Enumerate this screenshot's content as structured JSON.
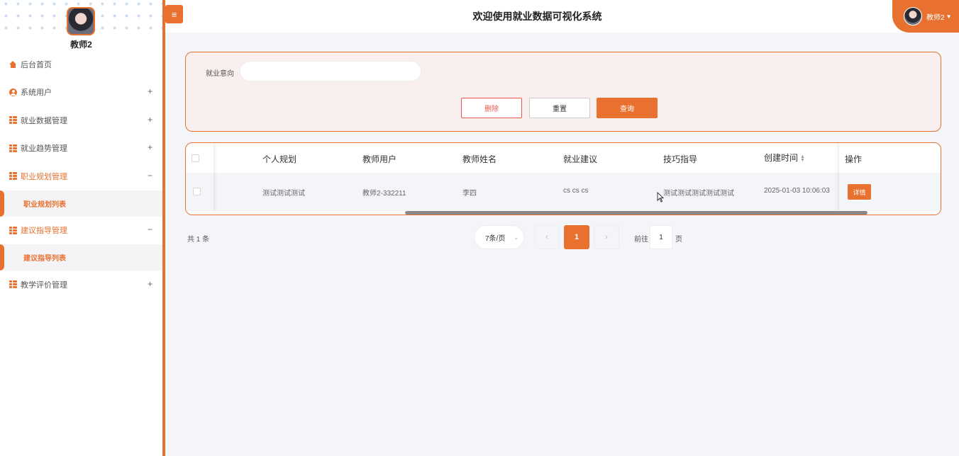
{
  "sidebar": {
    "user_name": "教师2",
    "items": [
      {
        "label": "后台首页",
        "icon": "home-icon",
        "toggle": ""
      },
      {
        "label": "系统用户",
        "icon": "user-icon",
        "toggle": "+"
      },
      {
        "label": "就业数据管理",
        "icon": "grid-icon",
        "toggle": "+"
      },
      {
        "label": "就业趋势管理",
        "icon": "grid-icon",
        "toggle": "+"
      },
      {
        "label": "职业规划管理",
        "icon": "grid-icon",
        "toggle": "−",
        "sub": "职业规划列表"
      },
      {
        "label": "建议指导管理",
        "icon": "grid-icon",
        "toggle": "−",
        "sub": "建议指导列表"
      },
      {
        "label": "教学评价管理",
        "icon": "grid-icon",
        "toggle": "+"
      }
    ]
  },
  "header": {
    "title": "欢迎使用就业数据可视化系统",
    "user": "教师2",
    "menu_icon": "≡"
  },
  "search": {
    "label": "就业意向",
    "value": "",
    "buttons": {
      "delete": "删除",
      "reset": "重置",
      "query": "查询"
    }
  },
  "table": {
    "columns": [
      "个人规划",
      "教师用户",
      "教师姓名",
      "就业建议",
      "技巧指导",
      "创建时间",
      "操作"
    ],
    "rows": [
      {
        "plan": "测试测试测试",
        "teacher_user": "教师2-332211",
        "teacher_name": "李四",
        "advice": "cs cs cs",
        "guidance": "测试测试测试测试测试",
        "created": "2025-01-03 10:06:03",
        "action": "详情"
      }
    ]
  },
  "pagination": {
    "total": "共 1 条",
    "page_size": "7条/页",
    "current": "1",
    "goto_label": "前往",
    "goto_value": "1",
    "unit": "页"
  },
  "colors": {
    "accent": "#e8712f",
    "danger": "#e35a4a"
  }
}
